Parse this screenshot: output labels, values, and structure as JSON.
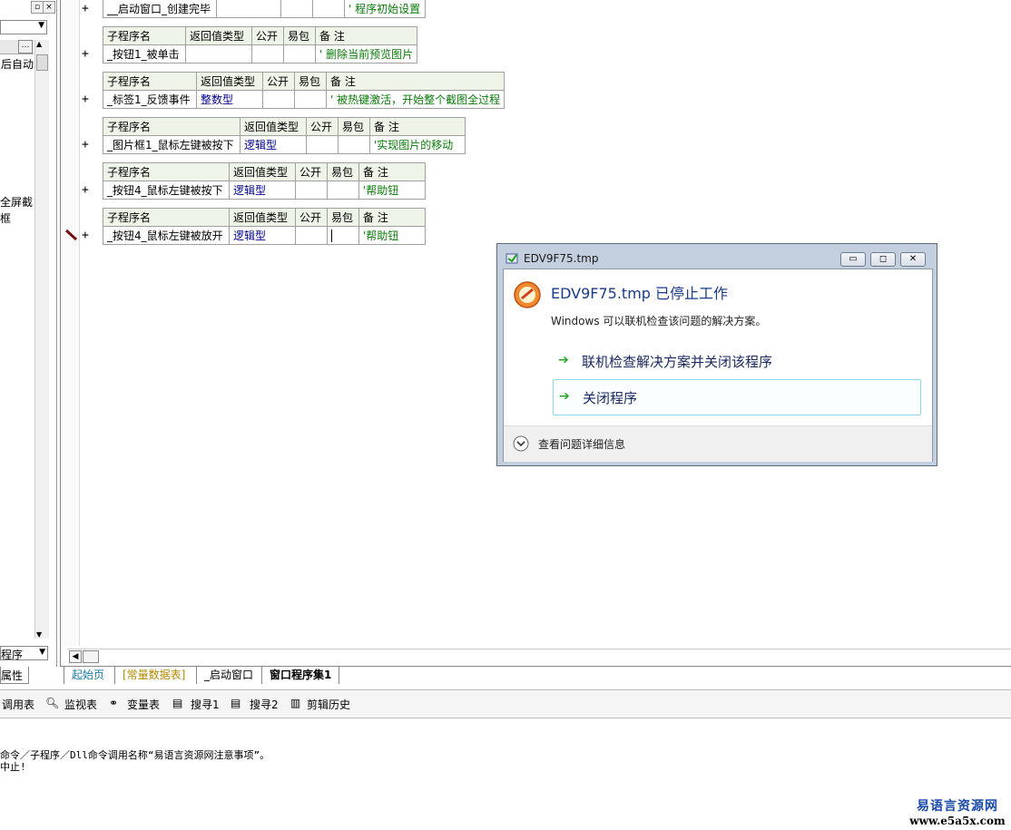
{
  "left_panel": {
    "text_auto": "后自动",
    "text_fullscreen": "全屏截",
    "text_frame": "框",
    "dropdown_value": "程序",
    "tab_label": "属性"
  },
  "code": {
    "rows": [
      {
        "name": "__启动窗口_创建完毕",
        "note": "' 程序初始设置"
      },
      {
        "name": "_按钮1_被单击",
        "note": "' 删除当前预览图片"
      },
      {
        "name": "_标签1_反馈事件",
        "type": "整数型",
        "note": "' 被热键激活，开始整个截图全过程"
      },
      {
        "name": "_图片框1_鼠标左键被按下",
        "type": "逻辑型",
        "note": "'实现图片的移动"
      },
      {
        "name": "_按钮4_鼠标左键被按下",
        "type": "逻辑型",
        "note": "'帮助钮"
      },
      {
        "name": "_按钮4_鼠标左键被放开",
        "type": "逻辑型",
        "note": "'帮助钮"
      }
    ],
    "headers": {
      "name": "子程序名",
      "ret": "返回值类型",
      "public": "公开",
      "easy": "易包",
      "note": "备 注"
    },
    "plus": "+"
  },
  "tabs": [
    "起始页",
    "[常量数据表]",
    "_启动窗口",
    "窗口程序集1"
  ],
  "toolbar": [
    "调用表",
    "监视表",
    "变量表",
    "搜寻1",
    "搜寻2",
    "剪辑历史"
  ],
  "output": {
    "line1": "命令／子程序／Dll命令调用名称“易语言资源网注意事项”。",
    "line2": "中止!"
  },
  "dialog": {
    "title": "EDV9F75.tmp",
    "heading": "EDV9F75.tmp 已停止工作",
    "desc": "Windows 可以联机检查该问题的解决方案。",
    "option1": "联机检查解决方案并关闭该程序",
    "option2": "关闭程序",
    "details": "查看问题详细信息"
  },
  "watermark": {
    "line1": "易语言资源网",
    "line2": "www.e5a5x.com"
  },
  "colors": {
    "note": "#0a7a0a",
    "type": "#00008b",
    "header_bg": "#eef5e8",
    "dialog_heading": "#1a3a8a",
    "arrow": "#2aa52a"
  }
}
